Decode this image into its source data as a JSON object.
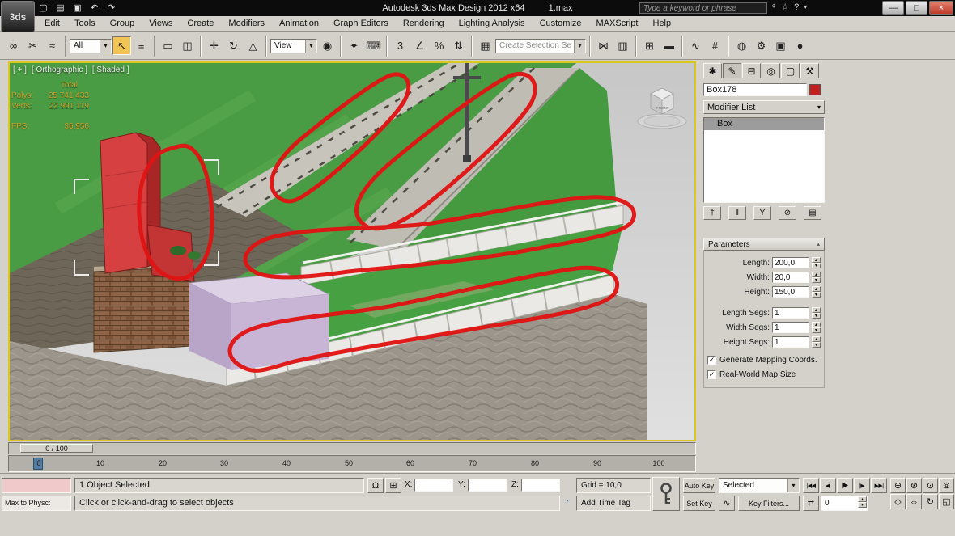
{
  "window": {
    "title": "Autodesk 3ds Max Design 2012 x64",
    "file": "1.max",
    "search_placeholder": "Type a keyword or phrase"
  },
  "menu": {
    "items": [
      "Edit",
      "Tools",
      "Group",
      "Views",
      "Create",
      "Modifiers",
      "Animation",
      "Graph Editors",
      "Rendering",
      "Lighting Analysis",
      "Customize",
      "MAXScript",
      "Help"
    ]
  },
  "toolbar": {
    "selection_filter": "All",
    "coord_system": "View",
    "named_selection": "Create Selection Se"
  },
  "viewport": {
    "label_plus": "[ + ]",
    "label_pov": "[ Orthographic ]",
    "label_shading": "[ Shaded ]",
    "viewcube_label": "FRONT",
    "stats": {
      "total_label": "Total",
      "polys_label": "Polys:",
      "polys_value": "25 741 433",
      "verts_label": "Verts:",
      "verts_value": "22 991 119",
      "fps_label": "FPS:",
      "fps_value": "36,956"
    }
  },
  "command_panel": {
    "object_name": "Box178",
    "modifier_list": "Modifier List",
    "stack_item": "Box",
    "parameters": {
      "title": "Parameters",
      "fields": [
        {
          "label": "Length:",
          "value": "200,0"
        },
        {
          "label": "Width:",
          "value": "20,0"
        },
        {
          "label": "Height:",
          "value": "150,0"
        },
        {
          "label": "Length Segs:",
          "value": "1"
        },
        {
          "label": "Width Segs:",
          "value": "1"
        },
        {
          "label": "Height Segs:",
          "value": "1"
        }
      ],
      "checkboxes": [
        {
          "label": "Generate Mapping Coords.",
          "checked": true
        },
        {
          "label": "Real-World Map Size",
          "checked": true
        }
      ]
    }
  },
  "timeline": {
    "slider_label": "0 / 100",
    "ticks": [
      "0",
      "10",
      "20",
      "30",
      "40",
      "50",
      "60",
      "70",
      "80",
      "90",
      "100"
    ]
  },
  "status": {
    "listener_line": "Max to Physc:",
    "status_line": "1 Object Selected",
    "prompt": "Click or click-and-drag to select objects",
    "x_label": "X:",
    "y_label": "Y:",
    "z_label": "Z:",
    "grid": "Grid = 10,0",
    "add_time_tag": "Add Time Tag",
    "auto_key": "Auto Key",
    "set_key": "Set Key",
    "selected_mode": "Selected",
    "key_filters": "Key Filters...",
    "frame": "0"
  },
  "icons": {
    "logo": "3ds",
    "new": "▢",
    "open": "▤",
    "save": "▣",
    "undo": "↶",
    "redo": "↷",
    "search": "⌖",
    "favorites": "☆",
    "help": "?",
    "caret": "▾",
    "minimize": "—",
    "maximize": "□",
    "close": "×",
    "link": "∞",
    "unlink": "✂",
    "bind_warp": "≈",
    "select": "↖",
    "by_name": "≡",
    "region": "▭",
    "crossing": "◫",
    "move": "✛",
    "rotate": "↻",
    "scale": "△",
    "pivot": "◉",
    "manipulate": "✦",
    "keyboard": "⌨",
    "snap": "3",
    "angle_snap": "∠",
    "percent_snap": "%",
    "spinner_snap": "⇅",
    "named_sets": "▦",
    "mirror": "⋈",
    "align": "▥",
    "layers": "⊞",
    "ribbon": "▬",
    "curve_editor": "∿",
    "schematic": "#",
    "material": "◍",
    "render_setup": "⚙",
    "render_frame": "▣",
    "render": "●",
    "tab_create": "✱",
    "tab_modify": "✎",
    "tab_hierarchy": "⊟",
    "tab_motion": "◎",
    "tab_display": "▢",
    "tab_utilities": "⚒",
    "pin": "†",
    "end_result": "‖",
    "make_unique": "Y",
    "remove_mod": "⊘",
    "configure": "▤",
    "rollup": "▴",
    "lock": "Ω",
    "abs_offset": "⊞",
    "time_tag": "◔",
    "go_start": "|◀◀",
    "prev_frame": "◀|",
    "play": "▶",
    "next_frame": "|▶",
    "go_end": "▶▶|",
    "key_mode": "⇄",
    "zoom": "⊕",
    "zoom_all": "⊛",
    "zoom_ext": "⊙",
    "zoom_ext_all": "⊚",
    "fov": "◇",
    "pan": "⇔",
    "orbit": "↻",
    "maximize_vp": "◱",
    "check": "✓",
    "spin_up": "▴",
    "spin_down": "▾"
  }
}
